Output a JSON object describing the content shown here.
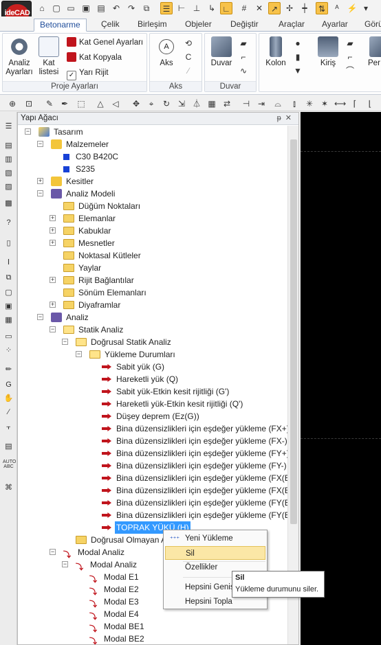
{
  "app": {
    "logo_text": "ideCAD"
  },
  "ribbon": {
    "tabs": [
      "Betonarme",
      "Çelik",
      "Birleşim",
      "Objeler",
      "Değiştir",
      "Araçlar",
      "Ayarlar",
      "Görü"
    ],
    "active_tab": "Betonarme",
    "groups": {
      "proje": {
        "label": "Proje Ayarları",
        "analiz_ayarlari": "Analiz Ayarları",
        "kat_listesi": "Kat listesi",
        "kat_genel": "Kat Genel Ayarları",
        "kat_kopyala": "Kat Kopyala",
        "yari_rijit": "Yarı Rijit"
      },
      "aks": {
        "label": "Aks",
        "aks_btn": "Aks",
        "aks_marker": "A"
      },
      "duvar": {
        "label": "Duvar",
        "duvar_btn": "Duvar"
      },
      "kolon": {
        "kolon_btn": "Kolon",
        "kiris_btn": "Kiriş",
        "per_btn": "Per"
      }
    }
  },
  "panel": {
    "title": "Yapı Ağacı",
    "pin": "ᵽ",
    "close": "✕"
  },
  "tree": {
    "root": "Tasarım",
    "malzemeler": "Malzemeler",
    "c30": "C30 B420C",
    "s235": "S235",
    "kesitler": "Kesitler",
    "analiz_modeli": "Analiz Modeli",
    "dugum": "Düğüm Noktaları",
    "elemanlar": "Elemanlar",
    "kabuklar": "Kabuklar",
    "mesnetler": "Mesnetler",
    "noktasal": "Noktasal Kütleler",
    "yaylar": "Yaylar",
    "rijit": "Rijit Bağlantılar",
    "sonum": "Sönüm Elemanları",
    "diyaframlar": "Diyaframlar",
    "analiz": "Analiz",
    "statik": "Statik Analiz",
    "dogrusal_statik": "Doğrusal Statik Analiz",
    "yukleme_durumlari": "Yükleme Durumları",
    "loads": [
      "Sabit yük (G)",
      "Hareketli yük (Q)",
      "Sabit yük-Etkin kesit rijitliği (G')",
      "Hareketli yük-Etkin kesit rijitliği (Q')",
      "Düşey deprem (Ez(G))",
      "Bina düzensizlikleri için eşdeğer yükleme (FX+)",
      "Bina düzensizlikleri için eşdeğer yükleme (FX-)",
      "Bina düzensizlikleri için eşdeğer yükleme (FY+)",
      "Bina düzensizlikleri için eşdeğer yükleme (FY-)",
      "Bina düzensizlikleri için eşdeğer yükleme (FX(B)",
      "Bina düzensizlikleri için eşdeğer yükleme (FX(B)",
      "Bina düzensizlikleri için eşdeğer yükleme (FY(B)",
      "Bina düzensizlikleri için eşdeğer yükleme (FY(B)",
      "TOPRAK YÜKÜ (H)"
    ],
    "dogrusal_olmayan": "Doğrusal Olmayan A",
    "modal_analiz_root": "Modal Analiz",
    "modal_analiz": "Modal Analiz",
    "modes": [
      "Modal E1",
      "Modal E2",
      "Modal E3",
      "Modal E4",
      "Modal BE1",
      "Modal BE2"
    ]
  },
  "context_menu": {
    "items": [
      "Yeni Yükleme",
      "Sil",
      "Özellikler",
      "Hepsini Genişlet",
      "Hepsini Topla"
    ],
    "hover_index": 1
  },
  "tooltip": {
    "title": "Sil",
    "text": "Yükleme durumunu siler."
  }
}
